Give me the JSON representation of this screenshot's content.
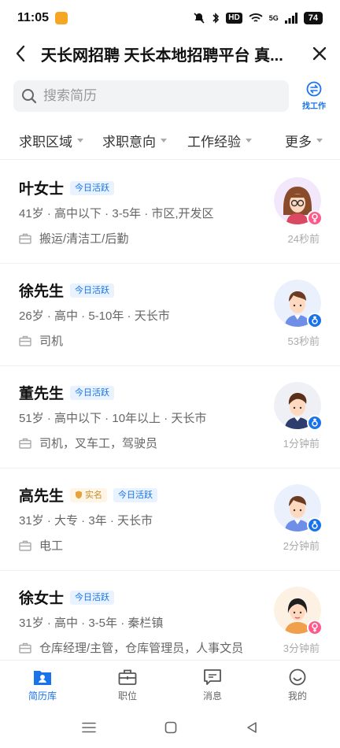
{
  "status": {
    "time": "11:05",
    "network": "HD",
    "signal": "5G",
    "battery": "74"
  },
  "header": {
    "title": "天长网招聘 天长本地招聘平台 真..."
  },
  "search": {
    "placeholder": "搜索简历",
    "find_job": "找工作"
  },
  "filters": [
    "求职区域",
    "求职意向",
    "工作经验",
    "更多"
  ],
  "candidates": [
    {
      "name": "叶女士",
      "verified": "",
      "active": "今日活跃",
      "info": "41岁 · 高中以下 · 3-5年 · 市区,开发区",
      "jobs": "搬运/清洁工/后勤",
      "time": "24秒前",
      "gender": "female",
      "avatar": "woman-glasses"
    },
    {
      "name": "徐先生",
      "verified": "",
      "active": "今日活跃",
      "info": "26岁 · 高中 · 5-10年 · 天长市",
      "jobs": "司机",
      "time": "53秒前",
      "gender": "male",
      "avatar": "man-blue"
    },
    {
      "name": "董先生",
      "verified": "",
      "active": "今日活跃",
      "info": "51岁 · 高中以下 · 10年以上 · 天长市",
      "jobs": "司机，叉车工，驾驶员",
      "time": "1分钟前",
      "gender": "male",
      "avatar": "man-brown"
    },
    {
      "name": "高先生",
      "verified": "实名",
      "active": "今日活跃",
      "info": "31岁 · 大专 · 3年 · 天长市",
      "jobs": "电工",
      "time": "2分钟前",
      "gender": "male",
      "avatar": "man-blue"
    },
    {
      "name": "徐女士",
      "verified": "",
      "active": "今日活跃",
      "info": "31岁 · 高中 · 3-5年 · 秦栏镇",
      "jobs": "仓库经理/主管，仓库管理员，人事文员",
      "time": "3分钟前",
      "gender": "female",
      "avatar": "woman-orange"
    }
  ],
  "tabbar": [
    {
      "label": "简历库",
      "icon": "resume-icon",
      "active": true
    },
    {
      "label": "职位",
      "icon": "briefcase-icon",
      "active": false
    },
    {
      "label": "消息",
      "icon": "message-icon",
      "active": false
    },
    {
      "label": "我的",
      "icon": "smile-icon",
      "active": false
    }
  ],
  "colors": {
    "accent": "#1a73e8",
    "female": "#ff5a8c",
    "male": "#1a73e8",
    "tag_bg": "#e8f3ff"
  }
}
